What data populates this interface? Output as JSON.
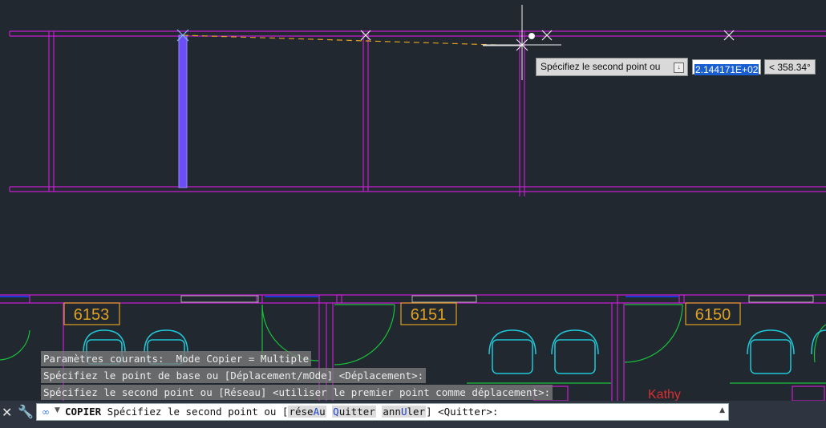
{
  "tooltip": {
    "prompt": "Spécifiez le second point ou",
    "input_value": "2.144171E+02",
    "angle": "< 358.34°"
  },
  "rooms": [
    "6153",
    "6151",
    "6150"
  ],
  "occupant": "Kathy",
  "history": [
    "Paramètres courants:  Mode Copier = Multiple",
    "Spécifiez le point de base ou [Déplacement/mOde] <Déplacement>:",
    "Spécifiez le second point ou [Réseau] <utiliser le premier point comme déplacement>:"
  ],
  "command": {
    "name": "COPIER",
    "prompt": " Spécifiez le second point ou [",
    "opt1_pre": "rése",
    "opt1_key": "A",
    "opt1_post": "u",
    "opt2_key": "Q",
    "opt2_post": "uitter",
    "opt3_pre": "ann",
    "opt3_key": "U",
    "opt3_post": "ler",
    "suffix": "] <Quitter>:"
  },
  "colors": {
    "background": "#212830",
    "walls": "#c51fd0",
    "selection": "#6b4ef5",
    "room_tag": "#e0a020",
    "door": "#19c23a",
    "chair": "#20c8d8",
    "occupant": "#d83030"
  }
}
